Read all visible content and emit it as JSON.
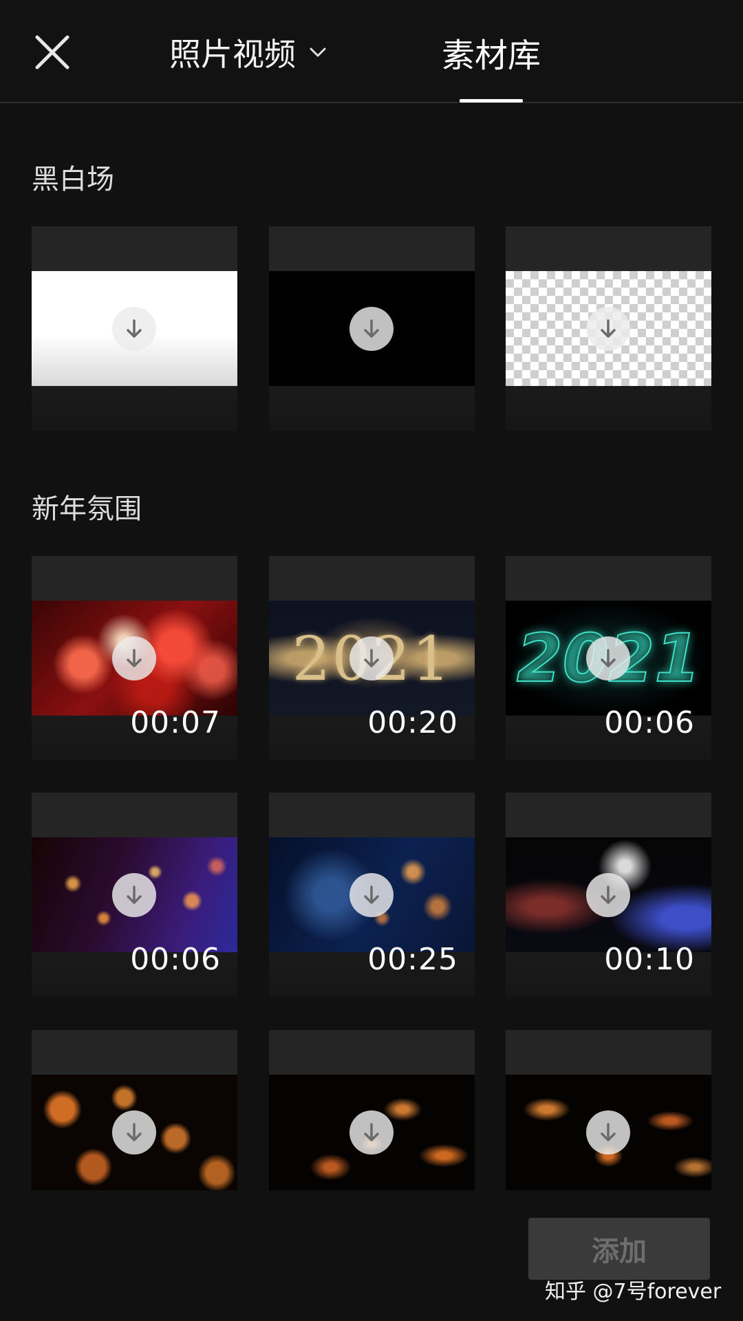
{
  "header": {
    "tab_photo_video": "照片视频",
    "tab_library": "素材库"
  },
  "sections": [
    {
      "title": "黑白场",
      "items": [
        {
          "thumb": "white-background"
        },
        {
          "thumb": "black-background"
        },
        {
          "thumb": "transparent-background"
        }
      ]
    },
    {
      "title": "新年氛围",
      "items": [
        {
          "thumb": "red-fireworks",
          "duration": "00:07"
        },
        {
          "thumb": "gold-2021-fireworks",
          "text": "2021",
          "duration": "00:20"
        },
        {
          "thumb": "neon-2021",
          "text": "2021",
          "duration": "00:06"
        },
        {
          "thumb": "purple-bokeh",
          "duration": "00:06"
        },
        {
          "thumb": "blue-gold-particles",
          "duration": "00:25"
        },
        {
          "thumb": "fireworks-night",
          "duration": "00:10"
        },
        {
          "thumb": "orange-bokeh"
        },
        {
          "thumb": "sparks"
        },
        {
          "thumb": "sparks-2"
        }
      ]
    }
  ],
  "footer": {
    "add_button": "添加",
    "watermark": "知乎 @7号forever"
  },
  "colors": {
    "background": "#111111",
    "tile": "#1c1c1c",
    "add_button_bg": "#3a3a3a",
    "add_button_text": "#6e6e6e"
  },
  "icons": {
    "close": "close-icon",
    "dropdown": "chevron-down-icon",
    "download": "download-icon"
  }
}
